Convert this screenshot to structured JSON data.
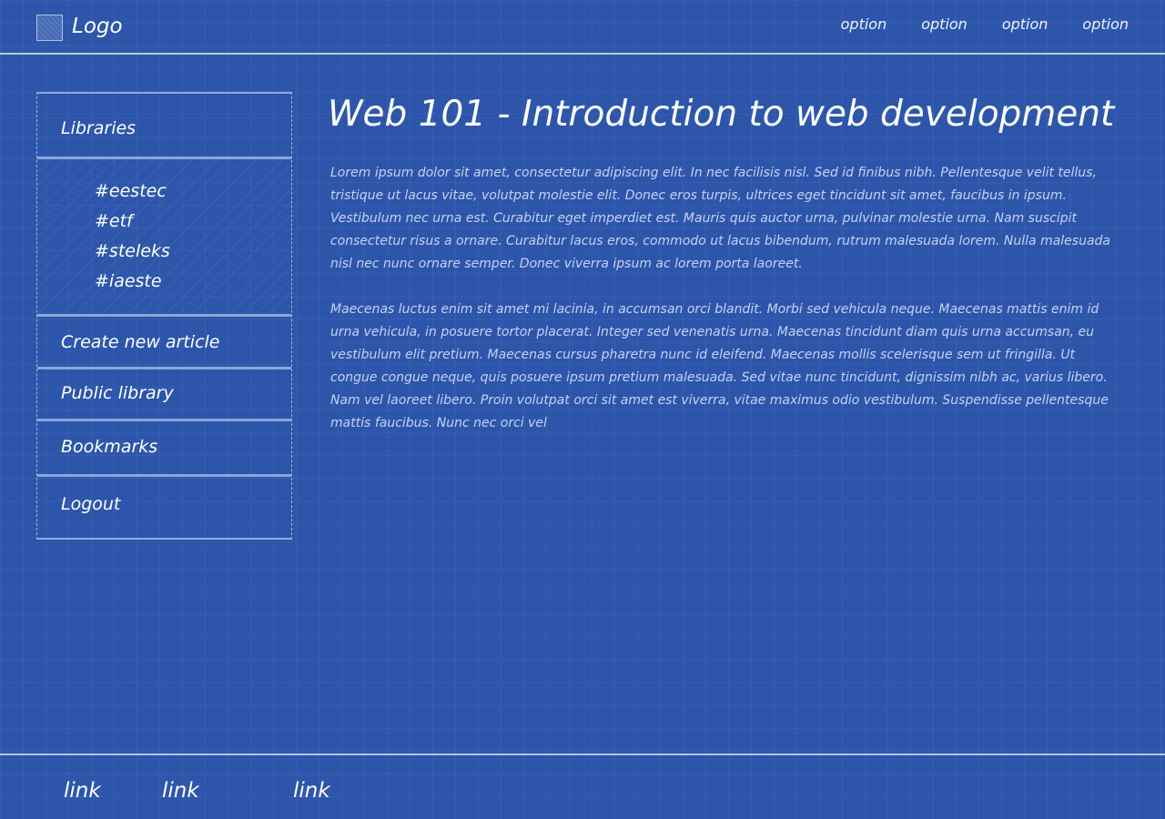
{
  "header": {
    "logo_text": "Logo",
    "options": [
      "option",
      "option",
      "option",
      "option"
    ]
  },
  "sidebar": {
    "libraries_label": "Libraries",
    "libraries": [
      "#eestec",
      "#etf",
      "#steleks",
      "#iaeste"
    ],
    "items": [
      "Create new article",
      "Public library",
      "Bookmarks",
      "Logout"
    ]
  },
  "main": {
    "title": "Web 101 - Introduction to web development",
    "paragraphs": [
      "Lorem ipsum dolor sit amet, consectetur adipiscing elit. In nec facilisis nisl. Sed id finibus nibh. Pellentesque velit tellus, tristique ut lacus vitae, volutpat molestie elit. Donec eros turpis, ultrices eget tincidunt sit amet, faucibus in ipsum. Vestibulum nec urna est. Curabitur eget imperdiet est. Mauris quis auctor urna, pulvinar molestie urna. Nam suscipit consectetur risus a ornare. Curabitur lacus eros, commodo ut lacus bibendum, rutrum malesuada lorem. Nulla malesuada nisl nec nunc ornare semper. Donec viverra ipsum ac lorem porta laoreet.",
      "Maecenas luctus enim sit amet mi lacinia, in accumsan orci blandit. Morbi sed vehicula neque. Maecenas mattis enim id urna vehicula, in posuere tortor placerat. Integer sed venenatis urna. Maecenas tincidunt diam quis urna accumsan, eu vestibulum elit pretium. Maecenas cursus pharetra nunc id eleifend. Maecenas mollis scelerisque sem ut fringilla. Ut congue congue neque, quis posuere ipsum pretium malesuada. Sed vitae nunc tincidunt, dignissim nibh ac, varius libero. Nam vel laoreet libero. Proin volutpat orci sit amet est viverra, vitae maximus odio vestibulum. Suspendisse pellentesque mattis faucibus. Nunc nec orci vel"
    ]
  },
  "footer": {
    "links": [
      "link",
      "link",
      "link"
    ]
  },
  "colors": {
    "background": "#2d56ab",
    "text": "#ffffff"
  }
}
